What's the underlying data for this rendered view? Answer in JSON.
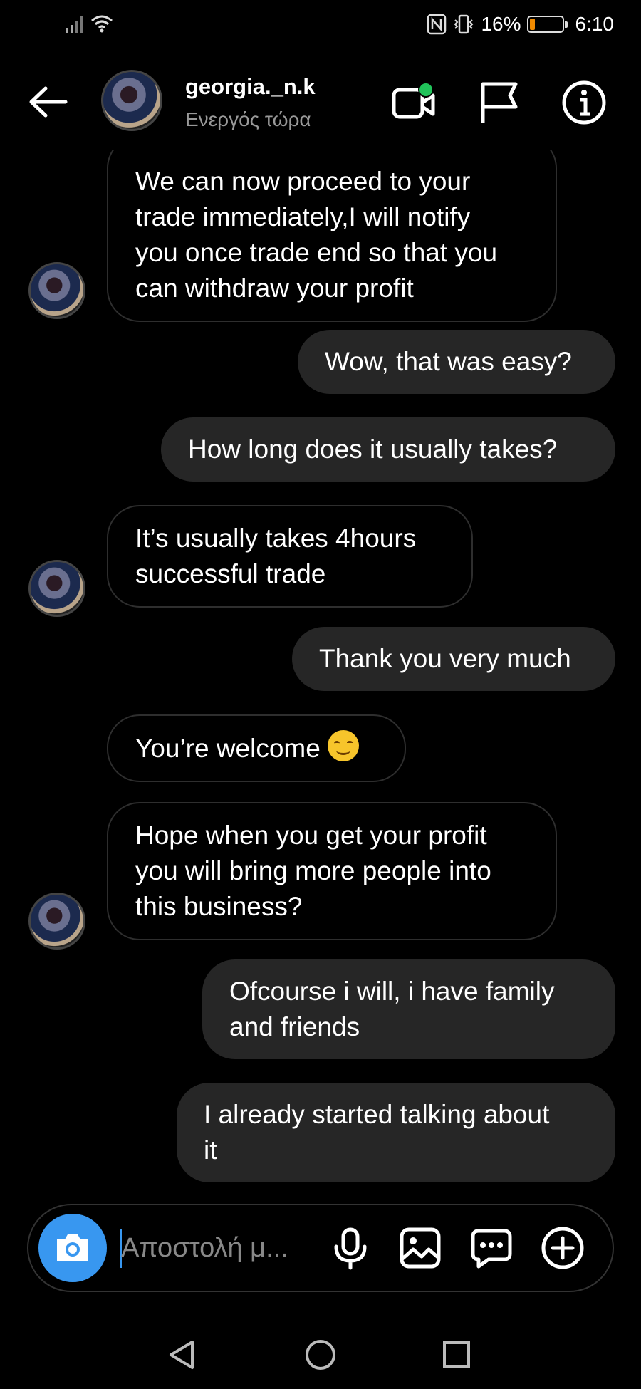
{
  "status_bar": {
    "battery_percent": "16%",
    "battery_level": 0.16,
    "time": "6:10"
  },
  "header": {
    "username": "georgia._n.k",
    "presence": "Ενεργός τώρα"
  },
  "messages": [
    {
      "text_lines": [
        "We can now proceed to your",
        "trade immediately,I will notify",
        "you once trade end so that you",
        "can withdraw your profit"
      ],
      "direction": "in"
    },
    {
      "text_lines": [
        "Wow, that was easy?"
      ],
      "direction": "out"
    },
    {
      "text_lines": [
        "How long does it usually takes?"
      ],
      "direction": "out"
    },
    {
      "text_lines": [
        "It’s usually takes 4hours",
        "successful trade"
      ],
      "direction": "in"
    },
    {
      "text_lines": [
        "Thank you very much"
      ],
      "direction": "out"
    },
    {
      "text_lines": [
        "You’re welcome"
      ],
      "direction": "in",
      "emoji": "smiling-face"
    },
    {
      "text_lines": [
        "Hope when you get your profit",
        "you will bring more people into",
        "this business?"
      ],
      "direction": "in"
    },
    {
      "text_lines": [
        "Ofcourse i will, i have family",
        "and friends"
      ],
      "direction": "out"
    },
    {
      "text_lines": [
        "I already started talking about",
        "it"
      ],
      "direction": "out"
    }
  ],
  "composer": {
    "placeholder": "Αποστολή μ..."
  },
  "colors": {
    "accent": "#3897f0",
    "online": "#21c35a",
    "outgoing_bubble": "#262626",
    "background": "#000000"
  }
}
